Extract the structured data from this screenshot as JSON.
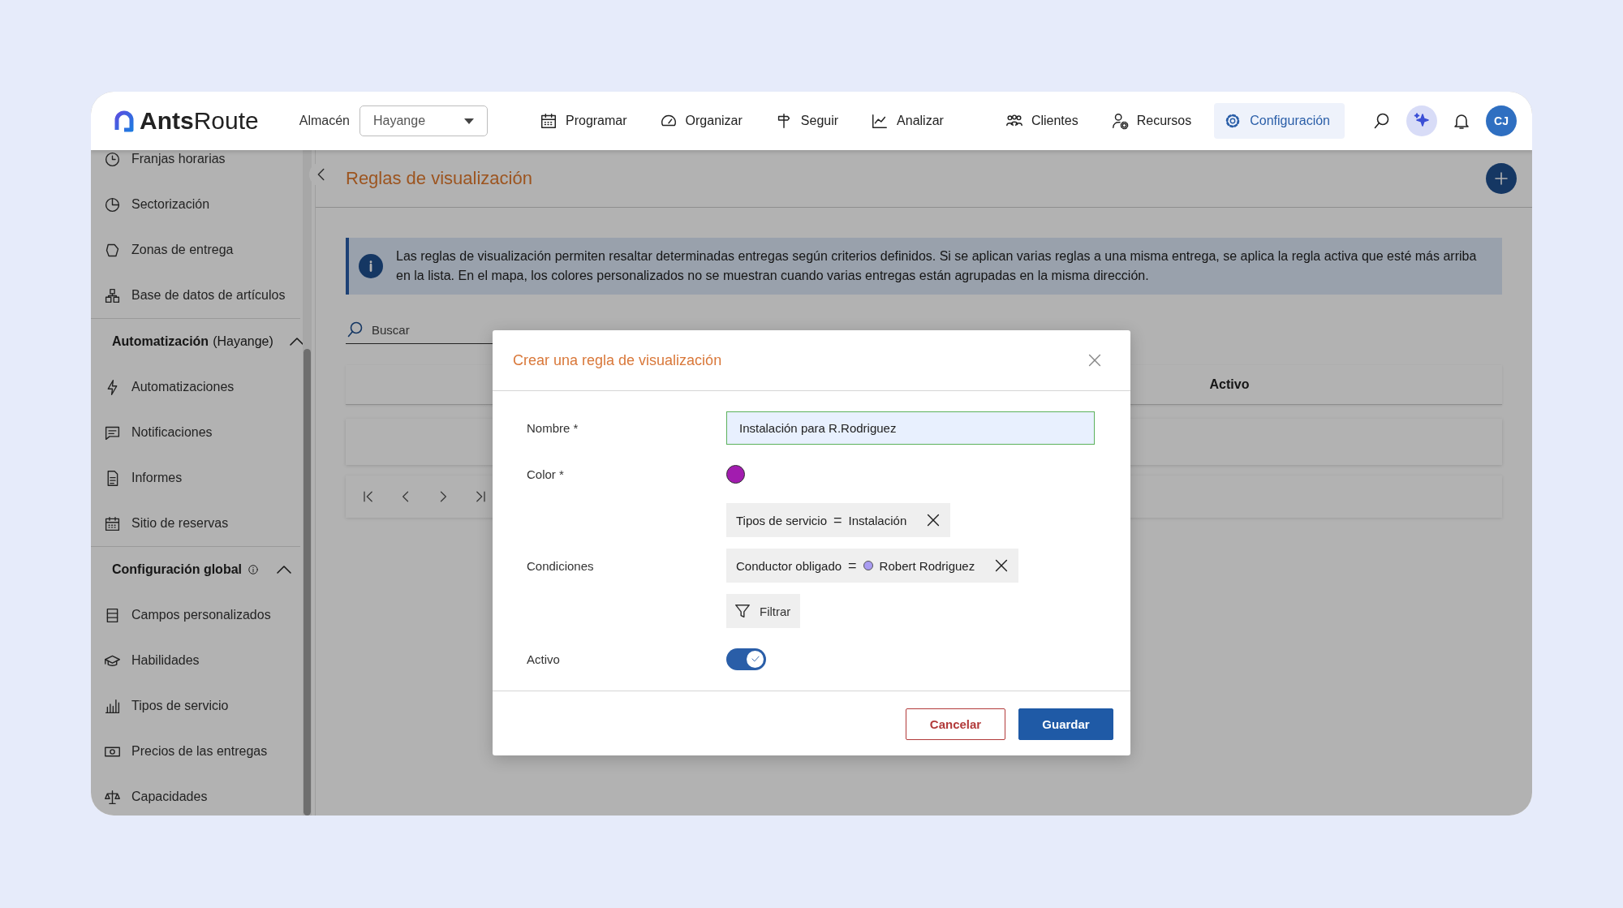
{
  "topbar": {
    "logo": "**Ants**Route",
    "warehouse_label": "Almacén",
    "warehouse_select": "Hayange",
    "nav": [
      {
        "label": "Programar",
        "selected": false
      },
      {
        "label": "Organizar",
        "selected": false
      },
      {
        "label": "Seguir",
        "selected": false
      },
      {
        "label": "Analizar",
        "selected": false
      },
      {
        "label": "Clientes",
        "selected": false
      },
      {
        "label": "Recursos",
        "selected": false
      },
      {
        "label": "Configuración",
        "selected": true
      }
    ],
    "avatar": "CJ"
  },
  "sidebar": {
    "sections": [
      {
        "items": [
          "Franjas horarias",
          "Sectorización",
          "Zonas de entrega",
          "Base de datos de artículos"
        ]
      },
      {
        "title": "Automatización",
        "subtitle": "(Hayange)",
        "expanded": true,
        "items": [
          "Automatizaciones",
          "Notificaciones",
          "Informes",
          "Sitio de reservas"
        ]
      },
      {
        "title": "Configuración global",
        "info": true,
        "expanded": true,
        "items": [
          "Campos personalizados",
          "Habilidades",
          "Tipos de servicio",
          "Precios de las entregas",
          "Capacidades"
        ]
      }
    ]
  },
  "page": {
    "title": "Reglas de visualización",
    "info": "Las reglas de visualización permiten resaltar determinadas entregas según criterios definidos. Si se aplican varias reglas a una misma entrega, se aplica la regla activa que esté más arriba en la lista. En el mapa, los colores personalizados no se muestran cuando varias entregas están agrupadas en la misma dirección.",
    "search": {
      "placeholder": "Buscar"
    },
    "table": {
      "columns": [
        "Activo"
      ]
    }
  },
  "dialog": {
    "title": "Crear una regla de visualización",
    "fields": [
      {
        "kind": "text",
        "label": "Nombre *",
        "value": "Instalación para R.Rodriguez"
      },
      {
        "kind": "color",
        "label": "Color *",
        "color": "#a21caf"
      },
      {
        "kind": "conditions",
        "label": "Condiciones",
        "conditions": [
          {
            "field": "Tipos de servicio",
            "operator": "=",
            "value": "Instalación"
          },
          {
            "field": "Conductor obligado",
            "operator": "=",
            "value": "Robert Rodriguez",
            "color": "#a99cf2"
          }
        ],
        "filter_button": "Filtrar"
      },
      {
        "kind": "toggle",
        "label": "Activo",
        "on": true
      }
    ],
    "buttons": [
      {
        "kind": "secondary",
        "label": "Cancelar"
      },
      {
        "kind": "primary",
        "label": "Guardar"
      }
    ]
  }
}
